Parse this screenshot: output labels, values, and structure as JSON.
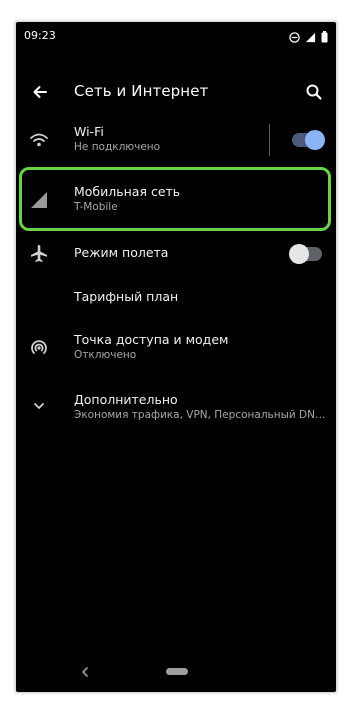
{
  "status_bar": {
    "time": "09:23"
  },
  "header": {
    "title": "Сеть и Интернет"
  },
  "items": [
    {
      "label": "Wi-Fi",
      "sub": "Не подключено"
    },
    {
      "label": "Мобильная сеть",
      "sub": "T-Mobile"
    },
    {
      "label": "Режим полета"
    },
    {
      "label": "Тарифный план"
    },
    {
      "label": "Точка доступа и модем",
      "sub": "Отключено"
    },
    {
      "label": "Дополнительно",
      "sub": "Экономия трафика, VPN, Персональный DN…"
    }
  ],
  "toggles": {
    "wifi_on": true,
    "airplane_on": false
  },
  "colors": {
    "accent": "#8ab4f8",
    "highlight": "#69d24a",
    "background": "#000000"
  }
}
